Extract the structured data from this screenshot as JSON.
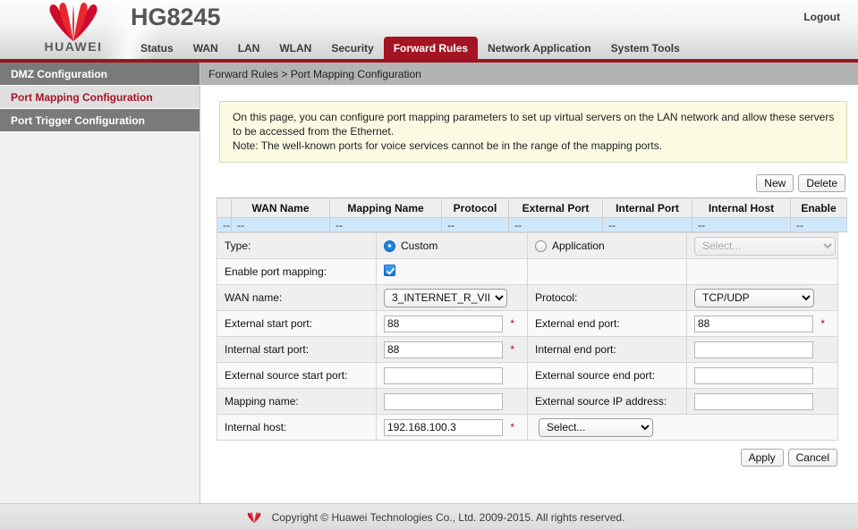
{
  "header": {
    "brand": "HUAWEI",
    "model": "HG8245",
    "logout_label": "Logout",
    "brand_color": "#cf0a2c",
    "accent_color": "#a51423"
  },
  "nav": {
    "items": [
      {
        "label": "Status",
        "active": false
      },
      {
        "label": "WAN",
        "active": false
      },
      {
        "label": "LAN",
        "active": false
      },
      {
        "label": "WLAN",
        "active": false
      },
      {
        "label": "Security",
        "active": false
      },
      {
        "label": "Forward Rules",
        "active": true
      },
      {
        "label": "Network Application",
        "active": false
      },
      {
        "label": "System Tools",
        "active": false
      }
    ]
  },
  "sidebar": {
    "items": [
      {
        "label": "DMZ Configuration",
        "active": false
      },
      {
        "label": "Port Mapping Configuration",
        "active": true
      },
      {
        "label": "Port Trigger Configuration",
        "active": false
      }
    ]
  },
  "main": {
    "breadcrumb": "Forward Rules > Port Mapping Configuration",
    "info_line1": "On this page, you can configure port mapping parameters to set up virtual servers on the LAN network and allow these servers to be accessed from the Ethernet.",
    "info_line2": "Note: The well-known ports for voice services cannot be in the range of the mapping ports."
  },
  "toolbar": {
    "new_label": "New",
    "delete_label": "Delete"
  },
  "table": {
    "columns": [
      "WAN Name",
      "Mapping Name",
      "Protocol",
      "External Port",
      "Internal Port",
      "Internal Host",
      "Enable"
    ],
    "rows": [
      {
        "select": "--",
        "cells": [
          "--",
          "--",
          "--",
          "--",
          "--",
          "--",
          "--"
        ]
      }
    ]
  },
  "form": {
    "type_label": "Type:",
    "type_custom_label": "Custom",
    "type_application_label": "Application",
    "type_selected": "custom",
    "application_select_value": "Select...",
    "application_select_disabled": true,
    "enable_label": "Enable port mapping:",
    "enable_checked": true,
    "wan_name_label": "WAN name:",
    "wan_name_value": "3_INTERNET_R_VII",
    "protocol_label": "Protocol:",
    "protocol_value": "TCP/UDP",
    "external_start_port_label": "External start port:",
    "external_start_port_value": "88",
    "external_start_port_required": "*",
    "external_end_port_label": "External end port:",
    "external_end_port_value": "88",
    "external_end_port_required": "*",
    "internal_start_port_label": "Internal start port:",
    "internal_start_port_value": "88",
    "internal_start_port_required": "*",
    "internal_end_port_label": "Internal end port:",
    "internal_end_port_value": "",
    "external_source_start_port_label": "External source start port:",
    "external_source_start_port_value": "",
    "external_source_end_port_label": "External source end port:",
    "external_source_end_port_value": "",
    "mapping_name_label": "Mapping name:",
    "mapping_name_value": "",
    "external_source_ip_label": "External source IP address:",
    "external_source_ip_value": "",
    "internal_host_label": "Internal host:",
    "internal_host_value": "192.168.100.3",
    "internal_host_required": "*",
    "internal_host_select_value": "Select..."
  },
  "actions": {
    "apply_label": "Apply",
    "cancel_label": "Cancel"
  },
  "footer": {
    "copyright": "Copyright © Huawei Technologies Co., Ltd. 2009-2015. All rights reserved."
  }
}
